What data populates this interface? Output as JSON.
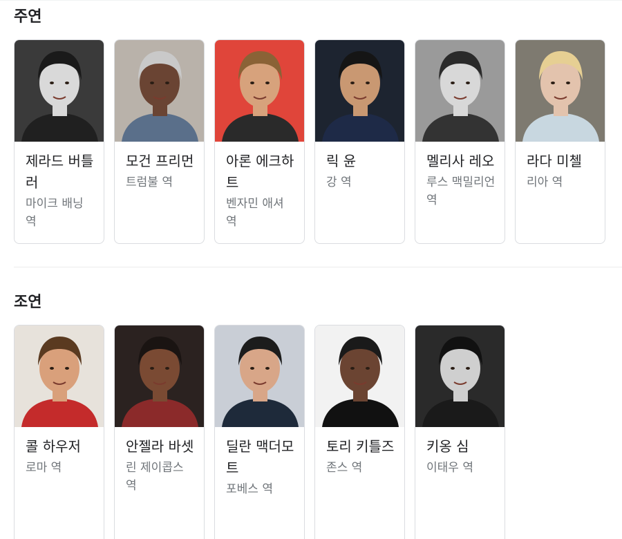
{
  "main_cast": {
    "title": "주연",
    "cards": [
      {
        "name": "제라드 버틀러",
        "role": "마이크 배닝 역",
        "bg": "#3a3a3a",
        "skin": "#d9d9d9",
        "hair": "#1a1a1a",
        "cloth": "#202020"
      },
      {
        "name": "모건 프리먼",
        "role": "트럼불 역",
        "bg": "#b9b2aa",
        "skin": "#6a4433",
        "hair": "#c9c9c9",
        "cloth": "#5a6f8a"
      },
      {
        "name": "아론 에크하트",
        "role": "벤자민 애셔 역",
        "bg": "#e0453a",
        "skin": "#d7a27c",
        "hair": "#8a6236",
        "cloth": "#2a2a2a"
      },
      {
        "name": "릭 윤",
        "role": "강 역",
        "bg": "#1d2430",
        "skin": "#c99872",
        "hair": "#151515",
        "cloth": "#1e2a47"
      },
      {
        "name": "멜리사 레오",
        "role": "루스 맥밀리언 역",
        "bg": "#9a9a9a",
        "skin": "#d8d8d8",
        "hair": "#2a2a2a",
        "cloth": "#333333"
      },
      {
        "name": "라다 미첼",
        "role": "리아 역",
        "bg": "#7e7a70",
        "skin": "#e3c3ad",
        "hair": "#e6cf93",
        "cloth": "#c8d7e0"
      }
    ]
  },
  "supporting_cast": {
    "title": "조연",
    "cards": [
      {
        "name": "콜 하우저",
        "role": "로마 역",
        "bg": "#e7e2db",
        "skin": "#d9a07b",
        "hair": "#5a3a20",
        "cloth": "#c42b2b"
      },
      {
        "name": "안젤라 바셋",
        "role": "린 제이콥스 역",
        "bg": "#2b2220",
        "skin": "#7a4a33",
        "hair": "#1a1412",
        "cloth": "#8b2a2a"
      },
      {
        "name": "딜란 맥더모트",
        "role": "포베스 역",
        "bg": "#c9ced6",
        "skin": "#d8a688",
        "hair": "#1c1c1c",
        "cloth": "#1e2a3a"
      },
      {
        "name": "토리 키틀즈",
        "role": "존스 역",
        "bg": "#f2f2f2",
        "skin": "#6b4432",
        "hair": "#1a1a1a",
        "cloth": "#111111"
      },
      {
        "name": "키옹 심",
        "role": "이태우 역",
        "bg": "#2a2a2a",
        "skin": "#cfcfcf",
        "hair": "#111111",
        "cloth": "#1a1a1a"
      }
    ]
  }
}
